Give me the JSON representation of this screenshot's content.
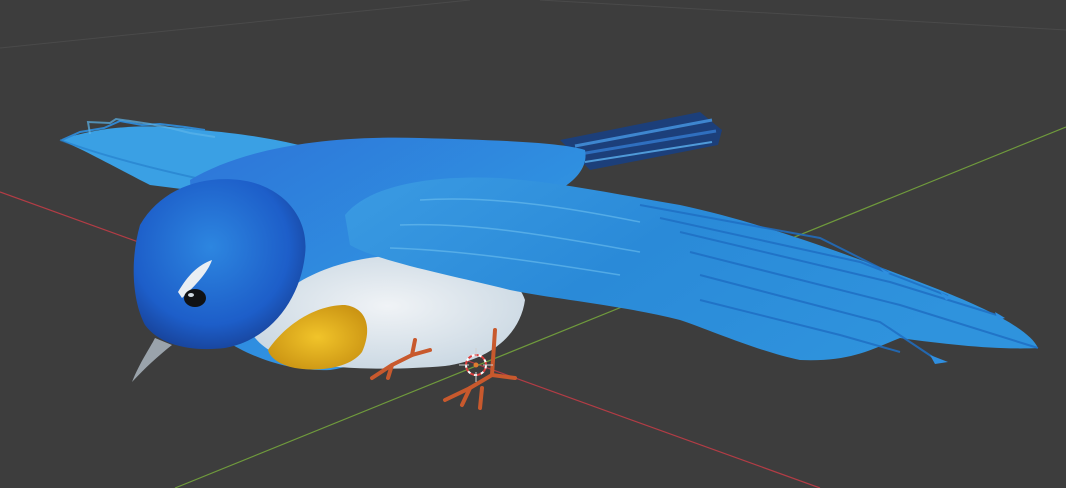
{
  "viewport": {
    "background": "#3d3d3d",
    "grid_color": "#4a4a4a",
    "x_axis_color": "#b23c45",
    "y_axis_color": "#6f9a3c",
    "cursor_color": "#e07b2f"
  },
  "model": {
    "subject": "bird",
    "colors": {
      "plumage": "#2f8fe0",
      "plumage_dark": "#1f5fc8",
      "belly": "#e8ecef",
      "breast_patch": "#e4b31f",
      "legs": "#c8592d",
      "beak": "#9aa3ab",
      "eye": "#101215",
      "tail": "#1c3f7a"
    }
  }
}
